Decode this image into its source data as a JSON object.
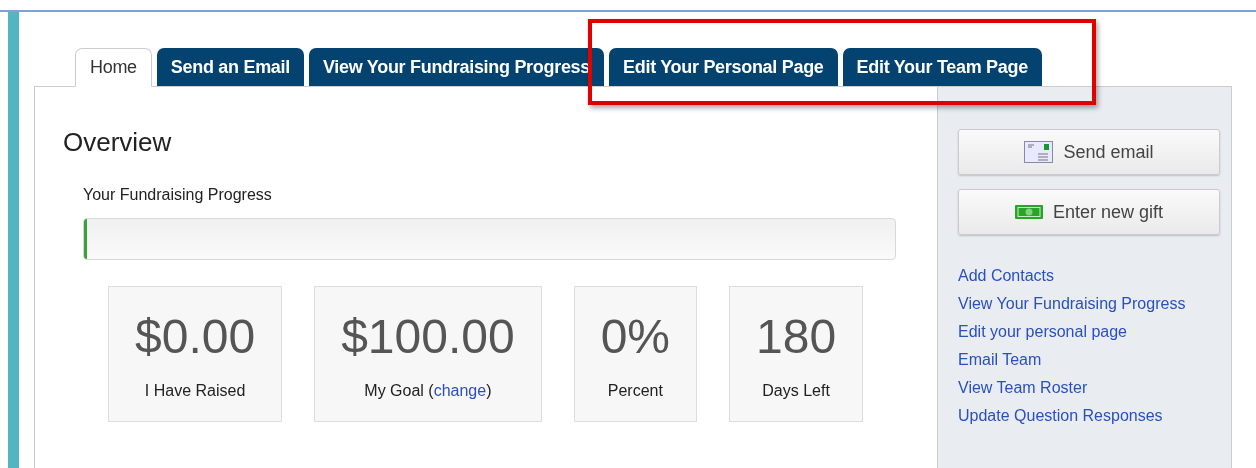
{
  "tabs": [
    {
      "label": "Home",
      "selected": true
    },
    {
      "label": "Send an Email",
      "selected": false
    },
    {
      "label": "View Your Fundraising Progress",
      "selected": false
    },
    {
      "label": "Edit Your Personal Page",
      "selected": false
    },
    {
      "label": "Edit Your Team Page",
      "selected": false
    }
  ],
  "annotation": {
    "kind": "box"
  },
  "overview": {
    "title": "Overview",
    "progress_label": "Your Fundraising Progress",
    "level": 0,
    "stats": [
      {
        "value": "$0.00",
        "label": "I Have Raised"
      },
      {
        "value": "$100.00",
        "label": "My Goal (",
        "link": "change",
        "label_after": ")"
      },
      {
        "value": "0%",
        "label": "Percent"
      },
      {
        "value": "180",
        "label": "Days Left"
      }
    ]
  },
  "sidebar": {
    "buttons": [
      {
        "kind": "email",
        "label": "Send email"
      },
      {
        "kind": "gift",
        "label": "Enter new gift"
      }
    ],
    "links": [
      "Add Contacts",
      "View Your Fundraising Progress",
      "Edit your personal page",
      "Email Team",
      "View Team Roster",
      "Update Question Responses"
    ]
  }
}
